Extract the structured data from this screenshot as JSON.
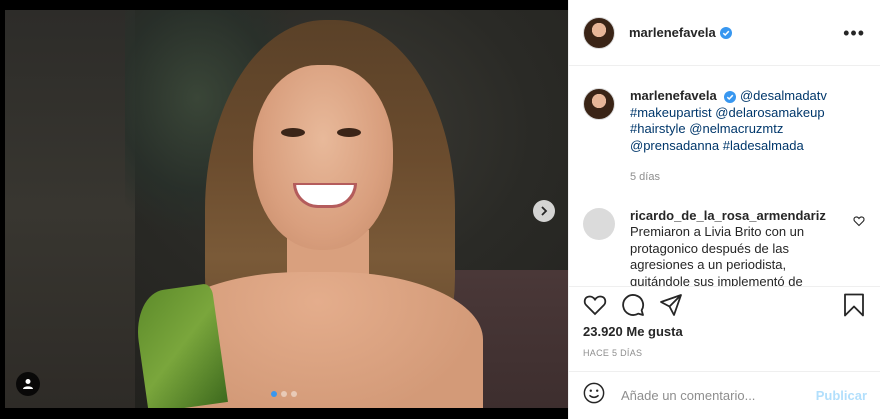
{
  "post": {
    "username": "marlenefavela",
    "caption_mentions": [
      "@desalmadatv",
      "#makeupartist",
      "@delarosamakeup",
      "#hairstyle",
      "@nelmacruzmtz",
      "@prensadanna",
      "#ladesalmada"
    ],
    "caption_time": "5 días",
    "likes": "23.920 Me gusta",
    "posted_ago": "HACE 5 DÍAS",
    "carousel": {
      "count": 3,
      "active_index": 0
    }
  },
  "comments": [
    {
      "username": "ricardo_de_la_rosa_armendariz",
      "text": "Premiaron a Livia Brito con un protagonico después de las agresiones a un periodista, quitándole sus implementó de"
    }
  ],
  "comment_box": {
    "placeholder": "Añade un comentario...",
    "publish_label": "Publicar"
  },
  "icons": {
    "verified": "verified-badge-icon",
    "more": "more-options-icon",
    "like": "heart-icon",
    "comment": "comment-icon",
    "share": "share-icon",
    "save": "bookmark-icon",
    "emoji": "emoji-icon",
    "next": "chevron-right-icon",
    "user_tag": "user-icon"
  },
  "colors": {
    "link": "#00376b",
    "verified": "#3897f0",
    "publish_disabled": "#b2dffc",
    "muted": "#8e8e8e"
  }
}
